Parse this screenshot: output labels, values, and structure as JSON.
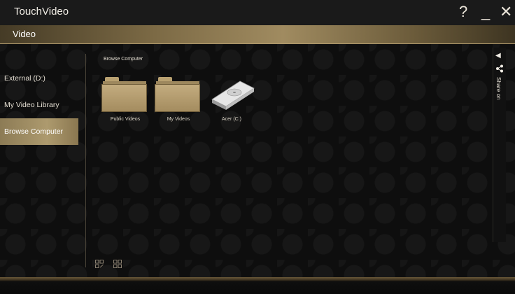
{
  "app": {
    "title": "TouchVideo"
  },
  "window_controls": {
    "help": "?",
    "minimize": "_",
    "close": "✕"
  },
  "section": {
    "label": "Video"
  },
  "sidebar": {
    "items": [
      {
        "label": "External (D:)",
        "active": false
      },
      {
        "label": "My Video Library",
        "active": false
      },
      {
        "label": "Browse Computer",
        "active": true
      }
    ]
  },
  "content": {
    "title": "Browse Computer",
    "tiles": [
      {
        "label": "Public Videos",
        "icon": "folder-icon"
      },
      {
        "label": "My Videos",
        "icon": "folder-icon"
      },
      {
        "label": "Acer (C:)",
        "icon": "hard-drive-icon"
      }
    ]
  },
  "share": {
    "label": "Share on",
    "toggle": "◀"
  },
  "colors": {
    "accent": "#a08b60",
    "active_item": "#ad9a6e",
    "background": "#0e0e0e"
  }
}
